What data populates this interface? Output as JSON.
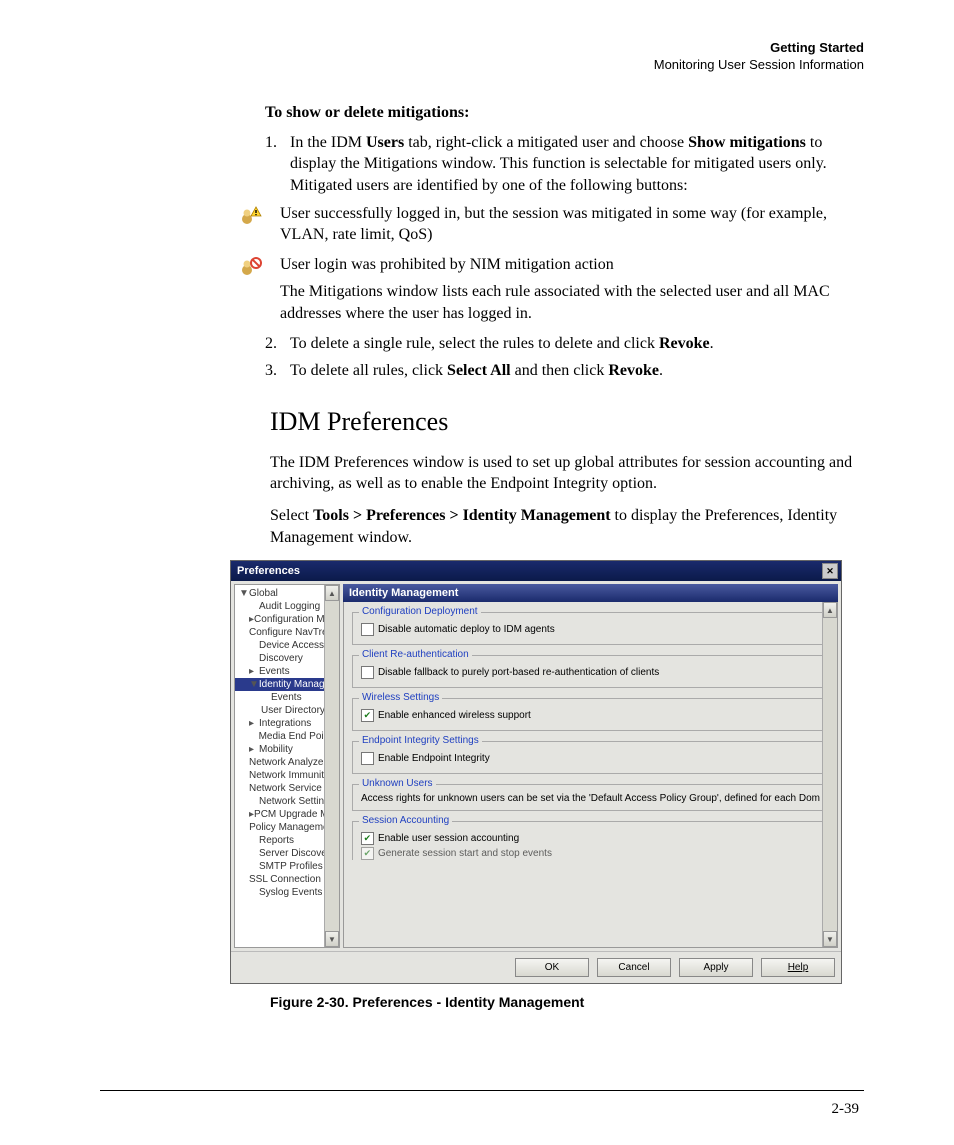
{
  "header": {
    "chapter": "Getting Started",
    "section": "Monitoring User Session Information"
  },
  "subhead": "To show or delete mitigations:",
  "steps": {
    "one_a": "In the IDM ",
    "one_b": "Users",
    "one_c": " tab, right-click a mitigated user and choose ",
    "one_d": "Show mitigations",
    "one_e": " to display the Mitigations window. This function is selectable for mitigated users only. Mitigated users are identified by one of the following buttons:",
    "icon1_text": "User successfully logged in, but the session was mitigated in some way (for example, VLAN, rate limit, QoS)",
    "icon2_text": "User login was prohibited by NIM mitigation action",
    "after_icons": "The Mitigations window lists each rule associated with the selected user and all MAC addresses where the user has logged in.",
    "two_a": "To delete a single rule, select the rules to delete and click ",
    "two_b": "Revoke",
    "two_c": ".",
    "three_a": "To delete all rules, click ",
    "three_b": "Select All",
    "three_c": " and then click ",
    "three_d": "Revoke",
    "three_e": "."
  },
  "h2": "IDM Preferences",
  "para1": "The IDM Preferences window is used to set up global attributes for session accounting and archiving, as well as to enable the Endpoint Integrity option.",
  "para2_a": "Select ",
  "para2_b": "Tools > Preferences > Identity Management",
  "para2_c": " to display the Preferences, Identity Management window.",
  "dialog": {
    "title": "Preferences",
    "right_title": "Identity Management",
    "tree": [
      {
        "lvl": 0,
        "arrow": "▼",
        "label": "Global"
      },
      {
        "lvl": 1,
        "arrow": "",
        "label": "Audit Logging"
      },
      {
        "lvl": 1,
        "arrow": "▸",
        "label": "Configuration Management"
      },
      {
        "lvl": 1,
        "arrow": "",
        "label": "Configure NavTree View"
      },
      {
        "lvl": 1,
        "arrow": "",
        "label": "Device Access"
      },
      {
        "lvl": 1,
        "arrow": "",
        "label": "Discovery"
      },
      {
        "lvl": 1,
        "arrow": "▸",
        "label": "Events"
      },
      {
        "lvl": 1,
        "arrow": "▼",
        "label": "Identity Management",
        "selected": true
      },
      {
        "lvl": 2,
        "arrow": "",
        "label": "Events"
      },
      {
        "lvl": 2,
        "arrow": "",
        "label": "User Directory Settings"
      },
      {
        "lvl": 1,
        "arrow": "▸",
        "label": "Integrations"
      },
      {
        "lvl": 1,
        "arrow": "",
        "label": "Media End Points"
      },
      {
        "lvl": 1,
        "arrow": "▸",
        "label": "Mobility"
      },
      {
        "lvl": 1,
        "arrow": "",
        "label": "Network Analyzer Report Config"
      },
      {
        "lvl": 1,
        "arrow": "",
        "label": "Network Immunity Manager"
      },
      {
        "lvl": 1,
        "arrow": "",
        "label": "Network Service Monitoring"
      },
      {
        "lvl": 1,
        "arrow": "",
        "label": "Network Settings"
      },
      {
        "lvl": 1,
        "arrow": "▸",
        "label": "PCM Upgrade Management"
      },
      {
        "lvl": 1,
        "arrow": "",
        "label": "Policy Management"
      },
      {
        "lvl": 1,
        "arrow": "",
        "label": "Reports"
      },
      {
        "lvl": 1,
        "arrow": "",
        "label": "Server Discovery"
      },
      {
        "lvl": 1,
        "arrow": "",
        "label": "SMTP Profiles"
      },
      {
        "lvl": 1,
        "arrow": "",
        "label": "SSL Connection Security"
      },
      {
        "lvl": 1,
        "arrow": "",
        "label": "Syslog Events"
      }
    ],
    "groups": {
      "g1_legend": "Configuration Deployment",
      "g1_chk": "Disable automatic deploy to IDM agents",
      "g2_legend": "Client Re-authentication",
      "g2_chk": "Disable fallback to purely port-based re-authentication of clients",
      "g3_legend": "Wireless Settings",
      "g3_chk": "Enable enhanced wireless support",
      "g4_legend": "Endpoint Integrity Settings",
      "g4_chk": "Enable Endpoint Integrity",
      "g5_legend": "Unknown Users",
      "g5_text": "Access rights for unknown users can be set via the 'Default Access Policy Group', defined for each Dom",
      "g6_legend": "Session Accounting",
      "g6_chk1": "Enable user session accounting",
      "g6_chk2": "Generate session start and stop events"
    },
    "buttons": {
      "ok": "OK",
      "cancel": "Cancel",
      "apply": "Apply",
      "help": "Help"
    }
  },
  "figure_caption": "Figure 2-30. Preferences - Identity Management",
  "page_number": "2-39"
}
